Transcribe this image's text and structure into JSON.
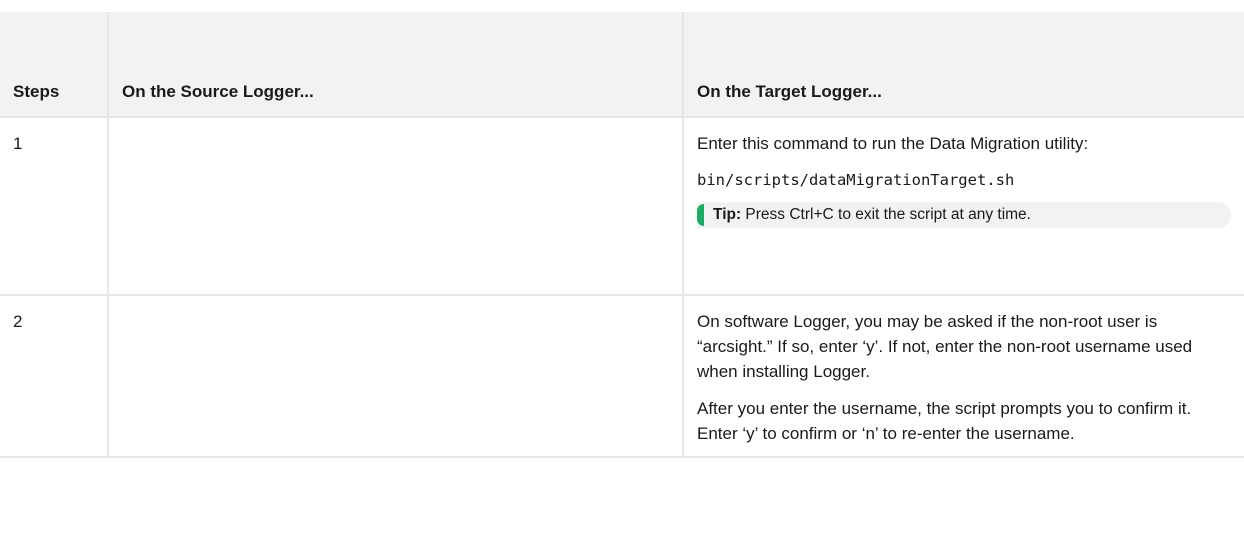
{
  "table": {
    "headers": {
      "steps": "Steps",
      "source": "On the Source Logger...",
      "target": "On the Target Logger..."
    },
    "rows": [
      {
        "step": "1",
        "source": "",
        "target_text": "Enter this command to run the Data Migration utility:",
        "target_code": "bin/scripts/dataMigrationTarget.sh",
        "tip_label": "Tip:",
        "tip_text": " Press Ctrl+C to exit the script at any time."
      },
      {
        "step": "2",
        "source": "",
        "target_para1": "On software Logger, you may be asked if the non-root user is “arcsight.” If so, enter ‘y’. If not, enter the non-root username used when installing Logger.",
        "target_para2": "After you enter the username, the script prompts you to confirm it. Enter ‘y’ to confirm or ‘n’ to re-enter the username."
      }
    ]
  },
  "colors": {
    "header_bg": "#f2f2f2",
    "border": "#e6e6e6",
    "tip_accent": "#1aac60"
  }
}
